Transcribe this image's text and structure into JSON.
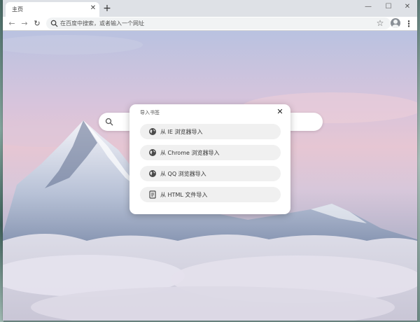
{
  "browser": {
    "tab": {
      "title": "主页"
    },
    "omnibox": {
      "placeholder": "在百度中搜索，或者输入一个网址"
    }
  },
  "icons": {
    "tab_close": "close-icon",
    "new_tab": "plus-icon",
    "minimize": "minimize-icon",
    "maximize": "maximize-icon",
    "close": "close-icon",
    "back": "arrow-left-icon",
    "forward": "arrow-right-icon",
    "reload": "reload-icon",
    "bookmark": "star-icon",
    "profile": "avatar-icon",
    "menu": "more-vertical-icon",
    "search": "search-icon",
    "globe": "globe-icon",
    "file": "document-icon"
  },
  "dialog": {
    "title": "导入书签",
    "options": [
      {
        "label": "从 IE 浏览器导入",
        "icon": "globe-icon"
      },
      {
        "label": "从 Chrome 浏览器导入",
        "icon": "globe-icon"
      },
      {
        "label": "从 QQ 浏览器导入",
        "icon": "globe-icon"
      },
      {
        "label": "从 HTML 文件导入",
        "icon": "document-icon"
      }
    ]
  },
  "colors": {
    "tabstrip": "#dee1e6",
    "omnibox": "#f1f3f4",
    "option_bg": "#f0f0f0"
  }
}
